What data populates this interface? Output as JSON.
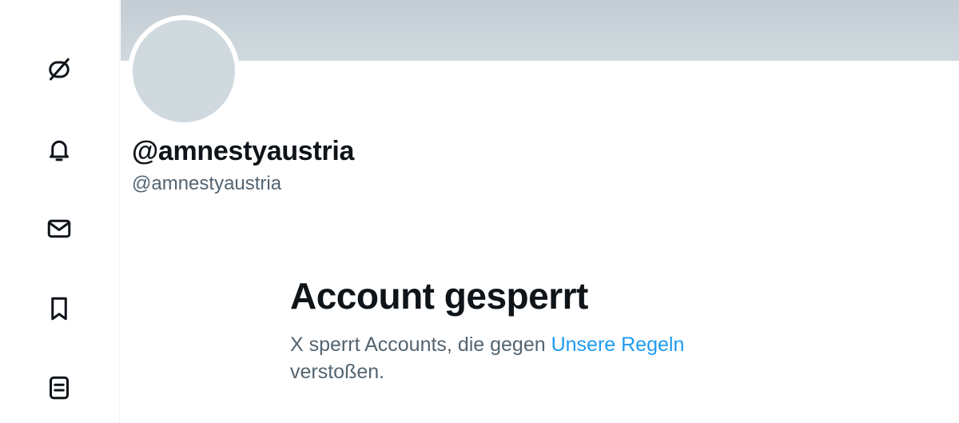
{
  "sidebar": {
    "items": [
      {
        "icon": "grok-icon"
      },
      {
        "icon": "bell-icon"
      },
      {
        "icon": "envelope-icon"
      },
      {
        "icon": "bookmark-icon"
      },
      {
        "icon": "list-icon"
      }
    ]
  },
  "profile": {
    "display_name": "@amnestyaustria",
    "handle": "@amnestyaustria"
  },
  "notice": {
    "title": "Account gesperrt",
    "text_before_link": "X sperrt Accounts, die gegen ",
    "link_text": "Unsere Regeln",
    "text_after_link": " verstoßen."
  },
  "colors": {
    "text_primary": "#0f1419",
    "text_secondary": "#536471",
    "link": "#1d9bf0",
    "banner": "#cfd9de",
    "avatar": "#cfd9de"
  }
}
